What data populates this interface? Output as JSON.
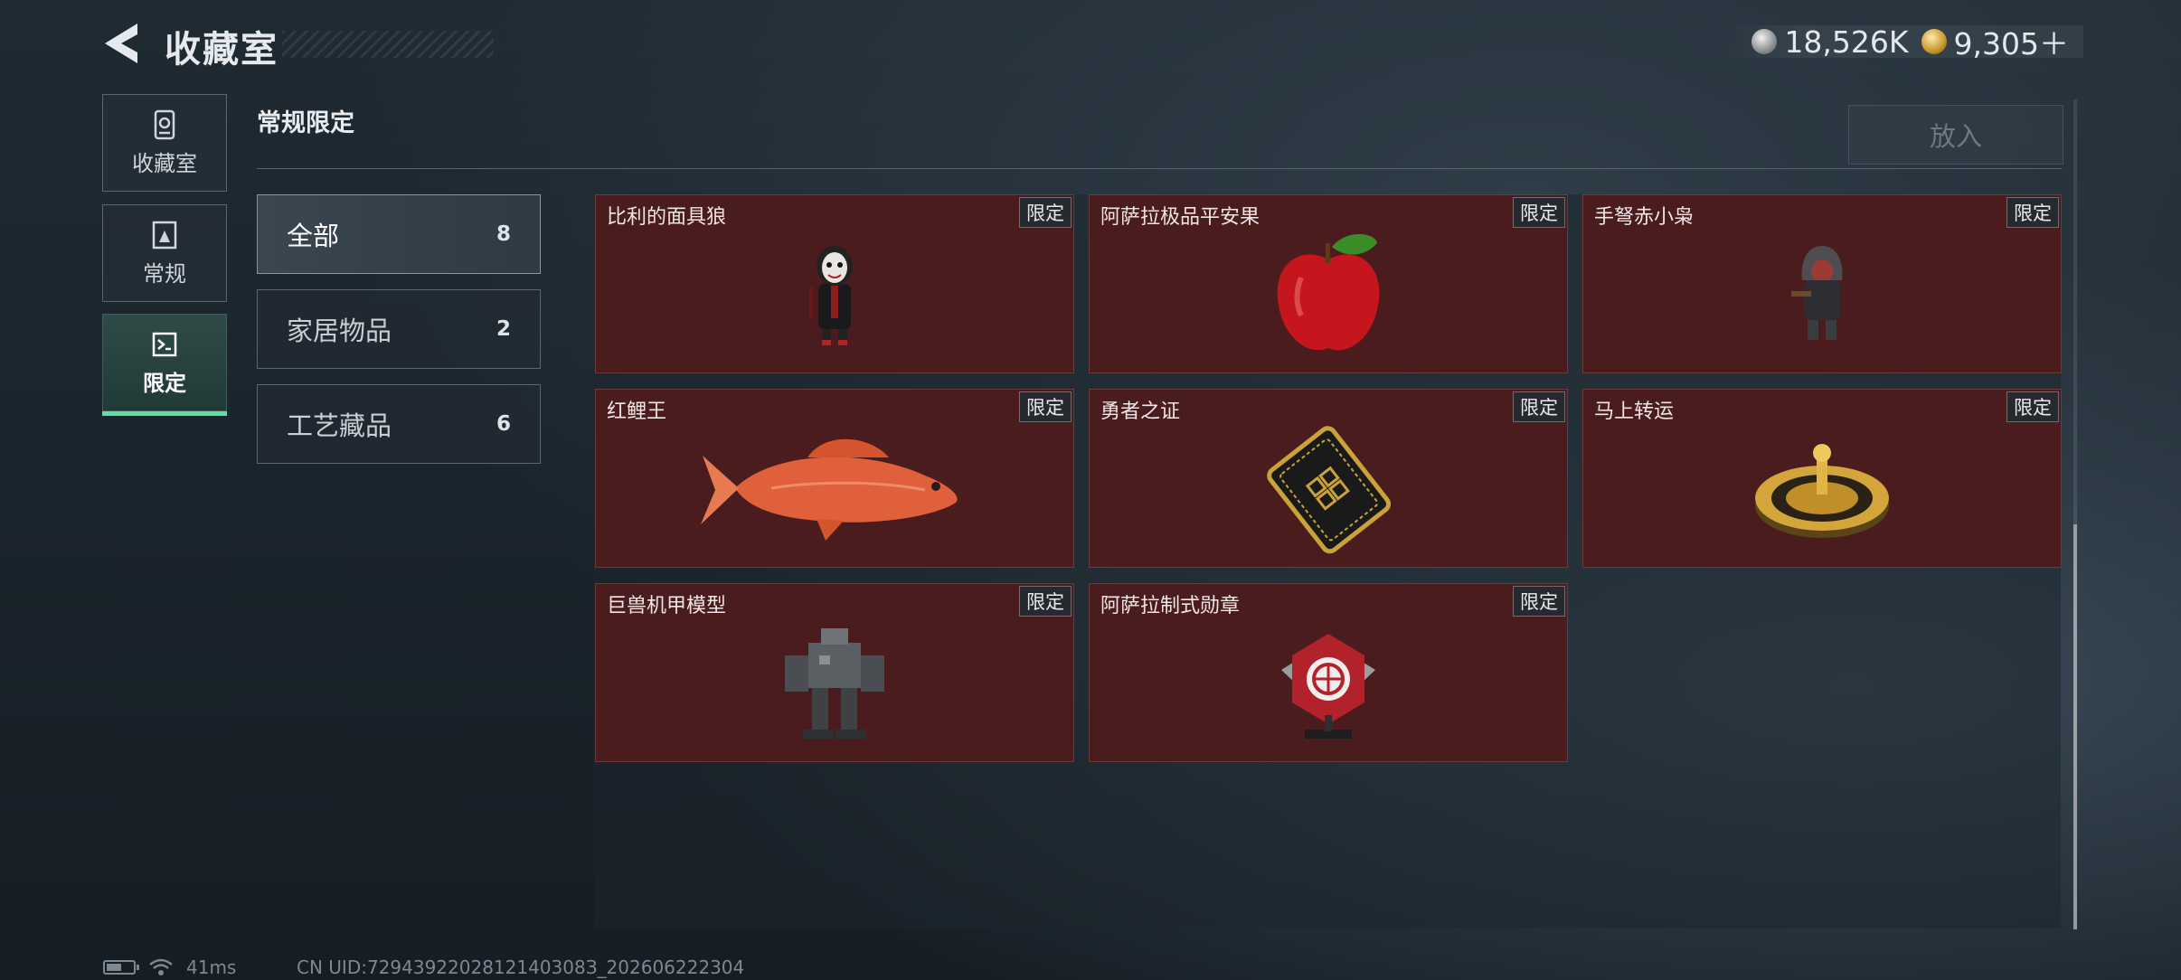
{
  "header": {
    "title": "收藏室"
  },
  "currency": [
    {
      "icon": "silver-coin-icon",
      "value": "18,526K"
    },
    {
      "icon": "gold-coin-icon",
      "value": "9,305＋"
    }
  ],
  "nav": [
    {
      "label": "收藏室",
      "icon": "collection-icon",
      "active": false
    },
    {
      "label": "常规",
      "icon": "regular-icon",
      "active": false
    },
    {
      "label": "限定",
      "icon": "limited-icon",
      "active": true
    }
  ],
  "section": {
    "title": "常规限定",
    "put_button": "放入"
  },
  "filters": [
    {
      "label": "全部",
      "count": "8",
      "active": true
    },
    {
      "label": "家居物品",
      "count": "2",
      "active": false
    },
    {
      "label": "工艺藏品",
      "count": "6",
      "active": false
    }
  ],
  "items": [
    {
      "name": "比利的面具狼",
      "tag": "限定",
      "art": "puppet-figure-icon"
    },
    {
      "name": "阿萨拉极品平安果",
      "tag": "限定",
      "art": "red-apple-icon"
    },
    {
      "name": "手弩赤小枭",
      "tag": "限定",
      "art": "hooded-figure-icon"
    },
    {
      "name": "红鲤王",
      "tag": "限定",
      "art": "red-carp-icon"
    },
    {
      "name": "勇者之证",
      "tag": "限定",
      "art": "black-card-icon"
    },
    {
      "name": "马上转运",
      "tag": "限定",
      "art": "golden-wheel-icon"
    },
    {
      "name": "巨兽机甲模型",
      "tag": "限定",
      "art": "mech-model-icon"
    },
    {
      "name": "阿萨拉制式勋章",
      "tag": "限定",
      "art": "medal-icon"
    }
  ],
  "status": {
    "ping": "41ms",
    "uid": "CN UID:7294392202812140308З_202606222304"
  }
}
